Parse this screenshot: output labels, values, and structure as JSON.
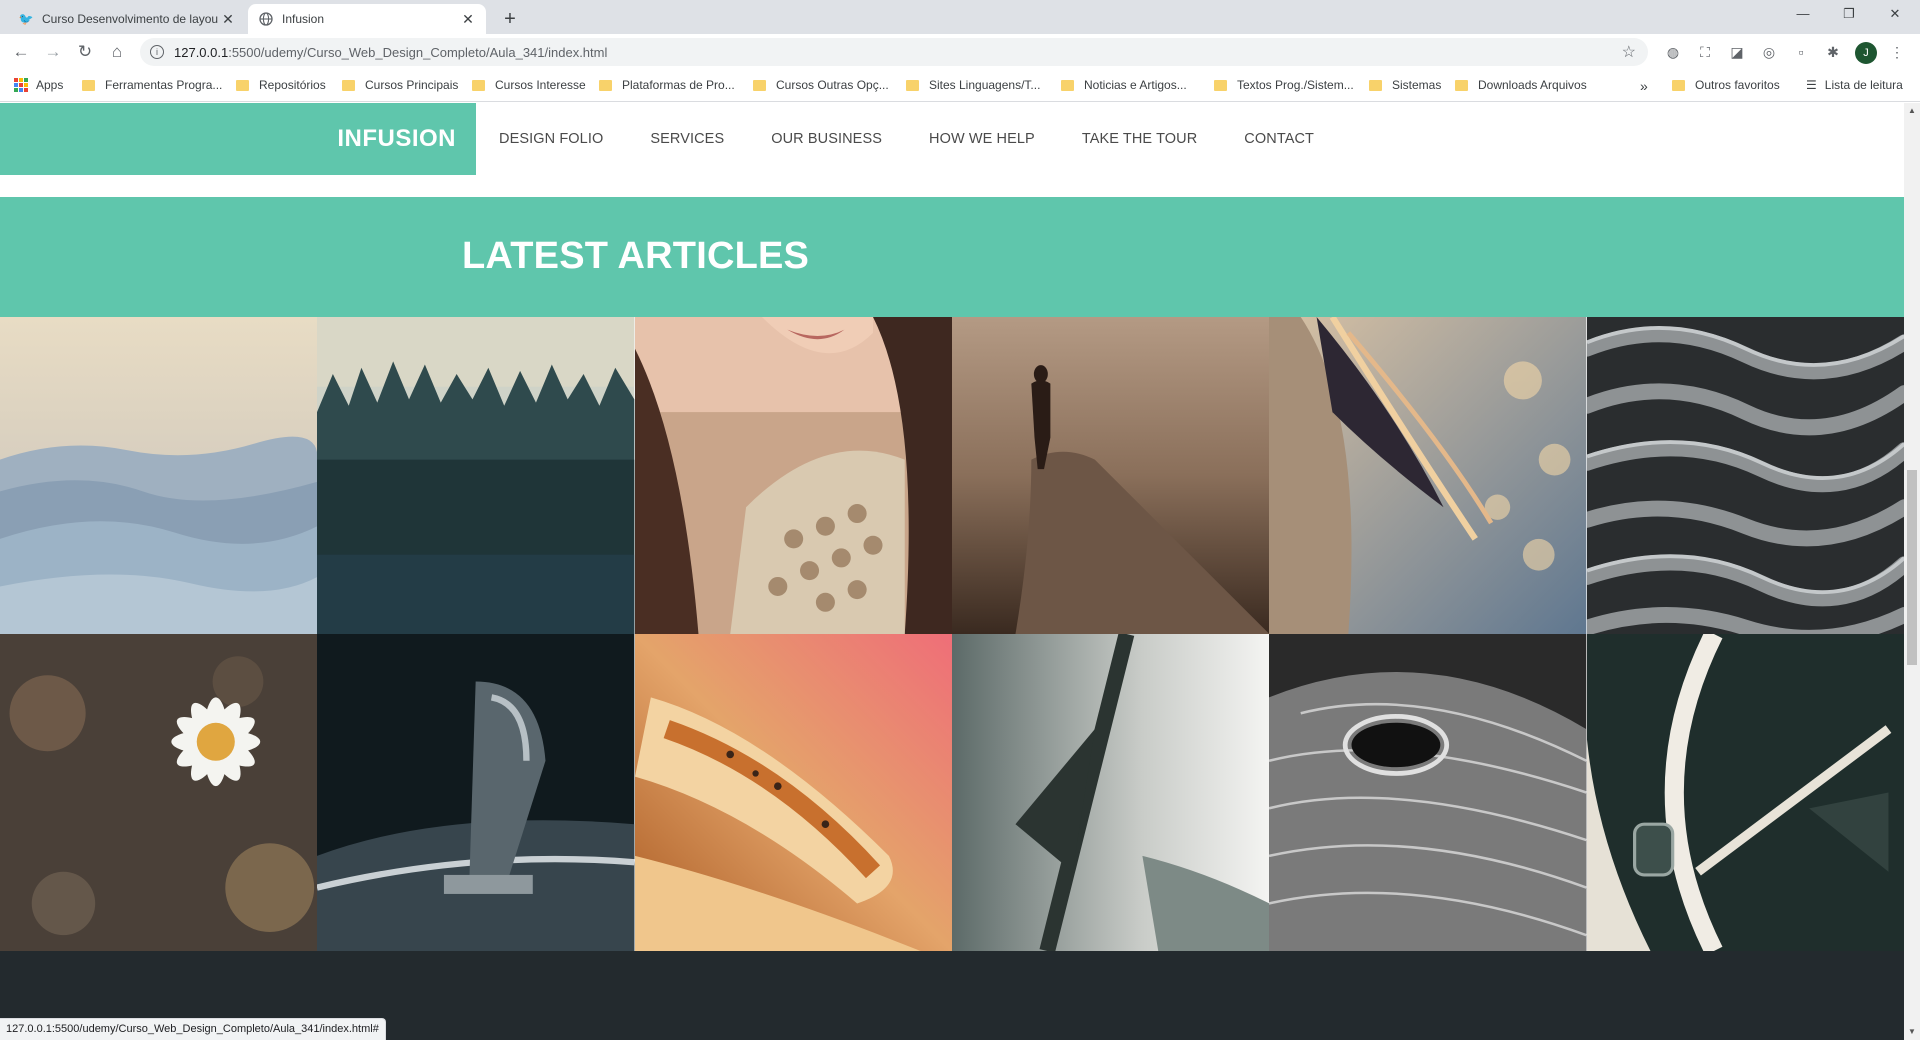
{
  "browser": {
    "tabs": [
      {
        "title": "Curso Desenvolvimento de layou",
        "active": false
      },
      {
        "title": "Infusion",
        "active": true
      }
    ],
    "url_host": "127.0.0.1",
    "url_rest": ":5500/udemy/Curso_Web_Design_Completo/Aula_341/index.html",
    "profile_initial": "J",
    "bookmarks": [
      "Apps",
      "Ferramentas Progra...",
      "Repositórios",
      "Cursos Principais",
      "Cursos Interesse",
      "Plataformas de Pro...",
      "Cursos Outras Opç...",
      "Sites Linguagens/T...",
      "Noticias e Artigos...",
      "Textos Prog./Sistem...",
      "Sistemas",
      "Downloads Arquivos"
    ],
    "bookmarks_overflow": "»",
    "other_bookmarks": "Outros favoritos",
    "reading_list": "Lista de leitura",
    "status_url": "127.0.0.1:5500/udemy/Curso_Web_Design_Completo/Aula_341/index.html#"
  },
  "site": {
    "brand": "INFUSION",
    "menu": [
      "DESIGN FOLIO",
      "SERVICES",
      "OUR BUSINESS",
      "HOW WE HELP",
      "TAKE THE TOUR",
      "CONTACT"
    ],
    "section_title": "LATEST ARTICLES",
    "accent_color": "#5fc6ac",
    "footer_color": "#232a2e"
  },
  "gallery": [
    "misty-mountains",
    "pine-forest",
    "woman-knit-sweater",
    "person-walking-road",
    "woman-hair-bokeh",
    "gray-ropes",
    "daisy-flower",
    "car-gear-shift",
    "bread-snack-closeup",
    "barbed-wire",
    "eagle-eye-closeup",
    "speedometer"
  ]
}
